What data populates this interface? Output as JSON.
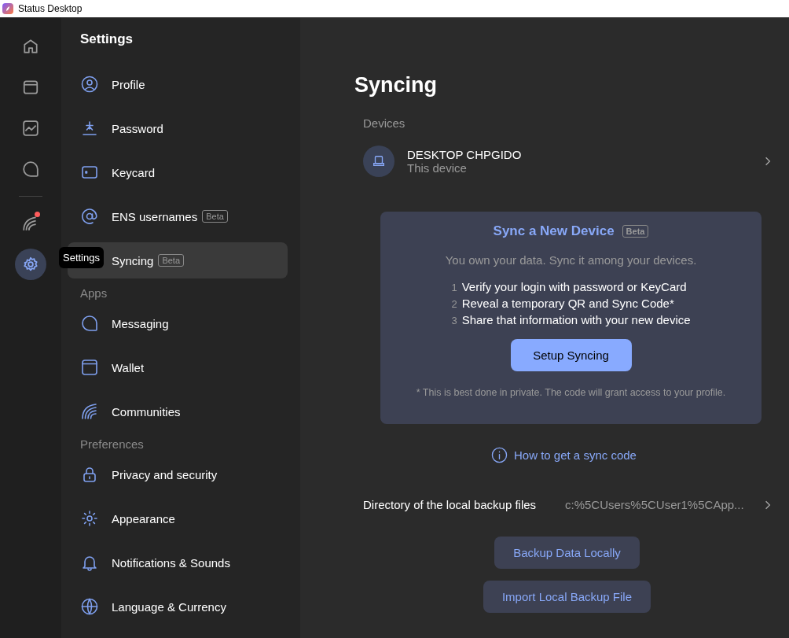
{
  "window": {
    "title": "Status Desktop"
  },
  "rail": [
    {
      "kind": "home",
      "selected": false,
      "notification": false
    },
    {
      "kind": "wallet",
      "selected": false,
      "notification": false
    },
    {
      "kind": "chart",
      "selected": false,
      "notification": false
    },
    {
      "kind": "chat",
      "selected": false,
      "notification": false
    }
  ],
  "rail_bottom": [
    {
      "kind": "communities",
      "selected": false,
      "notification": true
    },
    {
      "kind": "settings",
      "selected": true,
      "notification": false
    }
  ],
  "tooltip": "Settings",
  "sidebar": {
    "title": "Settings",
    "sections": [
      {
        "items": [
          {
            "label": "Profile",
            "selected": false
          },
          {
            "label": "Password",
            "selected": false
          },
          {
            "label": "Keycard",
            "selected": false
          },
          {
            "label": "ENS usernames",
            "badge": "Beta",
            "selected": false
          },
          {
            "label": "Syncing",
            "badge": "Beta",
            "selected": true
          }
        ]
      },
      {
        "heading": "Apps",
        "items": [
          {
            "label": "Messaging",
            "selected": false
          },
          {
            "label": "Wallet",
            "selected": false
          },
          {
            "label": "Communities",
            "selected": false
          }
        ]
      },
      {
        "heading": "Preferences",
        "items": [
          {
            "label": "Privacy and security",
            "selected": false
          },
          {
            "label": "Appearance",
            "selected": false
          },
          {
            "label": "Notifications & Sounds",
            "selected": false
          },
          {
            "label": "Language & Currency",
            "selected": false
          }
        ]
      }
    ]
  },
  "main": {
    "title": "Syncing",
    "devices_label": "Devices",
    "device": {
      "name": "DESKTOP CHPGIDO",
      "subtitle": "This device"
    },
    "card": {
      "title": "Sync a New Device",
      "badge": "Beta",
      "intro": "You own your data. Sync it among your devices.",
      "steps": [
        {
          "number": "1",
          "text": "Verify your login with password or KeyCard"
        },
        {
          "number": "2",
          "text": "Reveal a temporary QR and Sync Code*"
        },
        {
          "number": "3",
          "text": "Share that information with your new device"
        }
      ],
      "button": "Setup Syncing",
      "note": "* This is best done in private. The code will grant access to your profile."
    },
    "help_link": "How to get a sync code",
    "backup_dir": {
      "label": "Directory of the local backup files",
      "value": "c:%5CUsers%5CUser1%5CApp..."
    },
    "buttons": [
      "Backup Data Locally",
      "Import Local Backup File"
    ]
  }
}
